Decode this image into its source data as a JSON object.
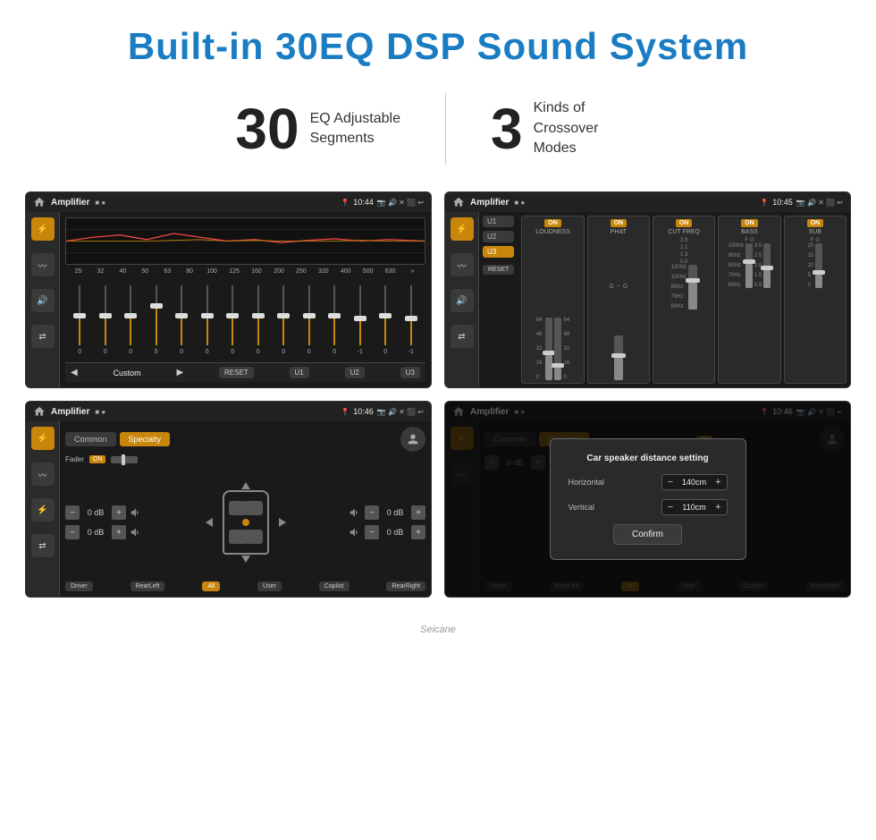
{
  "page": {
    "title": "Built-in 30EQ DSP Sound System",
    "accent_color": "#1a7dc4"
  },
  "stats": [
    {
      "number": "30",
      "desc_line1": "EQ Adjustable",
      "desc_line2": "Segments"
    },
    {
      "number": "3",
      "desc_line1": "Kinds of",
      "desc_line2": "Crossover Modes"
    }
  ],
  "screens": [
    {
      "id": "screen1",
      "title": "Amplifier",
      "time": "10:44",
      "type": "eq",
      "eq_freqs": [
        "25",
        "32",
        "40",
        "50",
        "63",
        "80",
        "100",
        "125",
        "160",
        "200",
        "250",
        "320",
        "400",
        "500",
        "630"
      ],
      "eq_vals": [
        "0",
        "0",
        "0",
        "5",
        "0",
        "0",
        "0",
        "0",
        "0",
        "0",
        "0",
        "-1",
        "0",
        "-1"
      ],
      "eq_preset": "Custom",
      "eq_buttons": [
        "RESET",
        "U1",
        "U2",
        "U3"
      ]
    },
    {
      "id": "screen2",
      "title": "Amplifier",
      "time": "10:45",
      "type": "crossover",
      "presets": [
        "U1",
        "U2",
        "U3"
      ],
      "active_preset": "U3",
      "channels": [
        {
          "name": "LOUDNESS",
          "on": true
        },
        {
          "name": "PHAT",
          "on": true
        },
        {
          "name": "CUT FREQ",
          "on": true
        },
        {
          "name": "BASS",
          "on": true
        },
        {
          "name": "SUB",
          "on": true
        }
      ],
      "reset_label": "RESET"
    },
    {
      "id": "screen3",
      "title": "Amplifier",
      "time": "10:46",
      "type": "speaker",
      "tabs": [
        "Common",
        "Specialty"
      ],
      "active_tab": "Specialty",
      "fader_label": "Fader",
      "fader_on": true,
      "dB_values": [
        "0 dB",
        "0 dB",
        "0 dB",
        "0 dB"
      ],
      "position_buttons": [
        "Driver",
        "RearLeft",
        "All",
        "User",
        "Copilot",
        "RearRight"
      ]
    },
    {
      "id": "screen4",
      "title": "Amplifier",
      "time": "10:46",
      "type": "speaker_modal",
      "tabs": [
        "Common",
        "Specialty"
      ],
      "modal": {
        "title": "Car speaker distance setting",
        "horizontal_label": "Horizontal",
        "horizontal_value": "140cm",
        "vertical_label": "Vertical",
        "vertical_value": "110cm",
        "confirm_label": "Confirm"
      }
    }
  ],
  "watermark": "Seicane"
}
